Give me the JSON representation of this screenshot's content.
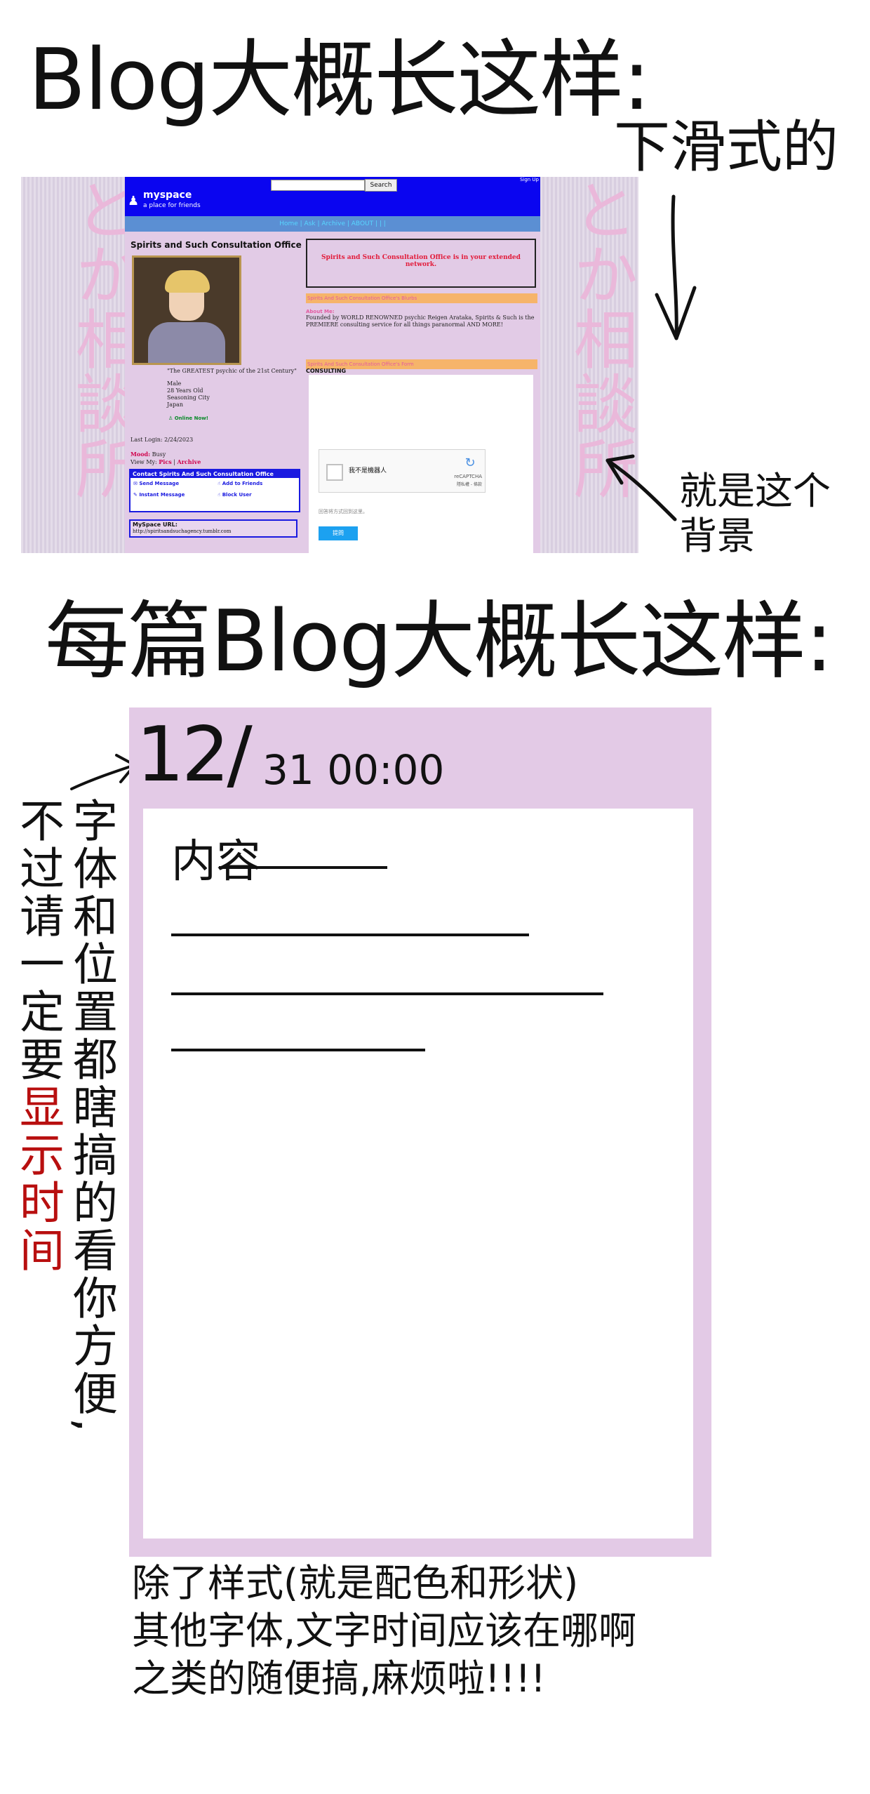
{
  "heading": {
    "main": "Blog大概长这样:",
    "sub": "下滑式的",
    "per_post": "每篇Blog大概长这样:"
  },
  "screenshot": {
    "background_text_left": "とか相談所",
    "background_text_right": "とか相談所",
    "topbar": {
      "logo": "myspace",
      "tagline": "a place for friends",
      "search_button": "Search",
      "sign_link": "Sign Up"
    },
    "nav": "Home | Ask | Archive | ABOUT | | |",
    "profile_name": "Spirits and Such Consultation Office",
    "quote": "\"The GREATEST psychic of the 21st Century\"",
    "details": [
      "Male",
      "28 Years Old",
      "Seasoning City",
      "Japan"
    ],
    "online": "Online Now!",
    "last_login": "Last Login: 2/24/2023",
    "mood_label": "Mood:",
    "mood_value": "Busy",
    "view_my": "View My:",
    "view_pics": "Pics",
    "view_archive": "Archive",
    "contact_title": "Contact Spirits And Such Consultation Office",
    "contact_items": [
      "Send Message",
      "Add to Friends",
      "Instant Message",
      "Block User"
    ],
    "url_label": "MySpace URL:",
    "url_value": "http://spiritsandsuchagency.tumblr.com",
    "network_text": "Spirits and Such Consultation Office is in your extended network.",
    "blurbs_title": "Spirits And Such Consultation Office's Blurbs",
    "about_label": "About Me:",
    "about_text": "Founded by WORLD RENOWNED psychic Reigen Arataka, Spirits & Such is the PREMIERE consulting service for all things paranormal AND MORE!",
    "form_title": "Spirits And Such Consultation Office's Form",
    "consulting_label": "CONSULTING",
    "captcha_label": "我不是機器人",
    "captcha_brand": "reCAPTCHA",
    "captcha_terms": "隱私權 - 條款",
    "form_note": "回答将方式回到这里。",
    "submit": "提問"
  },
  "notes": {
    "background_note": [
      "就是这个",
      "背景"
    ],
    "font_position_note": "字体和位置都瞎搞的看你方便,",
    "time_note_prefix": "不过请一定要",
    "time_note_red": "显示时间",
    "bottom_note": [
      "除了样式(就是配色和形状)",
      "其他字体,文字时间应该在哪啊",
      "之类的随便搞,麻烦啦!!!!"
    ]
  },
  "post": {
    "date": "12/",
    "time": "31 00:00",
    "content_label": "内容"
  },
  "colors": {
    "post_bg": "#e3cae6",
    "highlight_red": "#b80f0f",
    "myspace_blue": "#0a05f0"
  }
}
